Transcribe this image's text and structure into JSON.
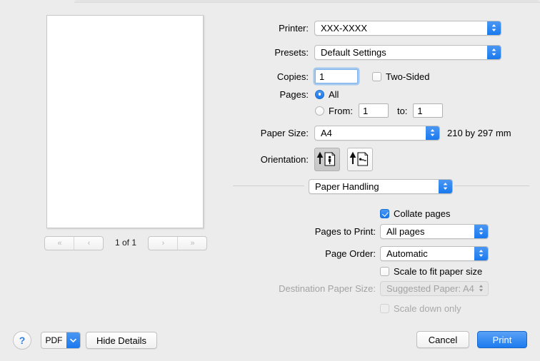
{
  "preview": {
    "pager": {
      "first_label": "«",
      "prev_label": "‹",
      "next_label": "›",
      "last_label": "»",
      "page_status": "1 of 1"
    }
  },
  "settings": {
    "printer": {
      "label": "Printer:",
      "value": "XXX-XXXX"
    },
    "presets": {
      "label": "Presets:",
      "value": "Default Settings"
    },
    "copies": {
      "label": "Copies:",
      "value": "1"
    },
    "two_sided": {
      "label": "Two-Sided",
      "checked": false
    },
    "pages": {
      "label": "Pages:",
      "all_label": "All",
      "from_label": "From:",
      "from_value": "1",
      "to_label": "to:",
      "to_value": "1",
      "selected": "all"
    },
    "paper_size": {
      "label": "Paper Size:",
      "value": "A4",
      "dimensions": "210 by 297 mm"
    },
    "orientation": {
      "label": "Orientation:",
      "portrait_name": "portrait",
      "landscape_name": "landscape",
      "selected": "portrait"
    },
    "pane": {
      "value": "Paper Handling"
    },
    "collate": {
      "label": "Collate pages",
      "checked": true
    },
    "pages_to_print": {
      "label": "Pages to Print:",
      "value": "All pages"
    },
    "page_order": {
      "label": "Page Order:",
      "value": "Automatic"
    },
    "scale_to_fit": {
      "label": "Scale to fit paper size",
      "checked": false
    },
    "destination_paper_size": {
      "label": "Destination Paper Size:",
      "value": "Suggested Paper: A4",
      "disabled": true
    },
    "scale_down_only": {
      "label": "Scale down only",
      "checked": false,
      "disabled": true
    }
  },
  "footer": {
    "help_label": "?",
    "pdf_label": "PDF",
    "hide_details_label": "Hide Details",
    "cancel_label": "Cancel",
    "print_label": "Print"
  },
  "colors": {
    "accent_blue": "#1a79ee",
    "window_bg": "#ececec",
    "disabled_text": "#a3a3a3"
  }
}
